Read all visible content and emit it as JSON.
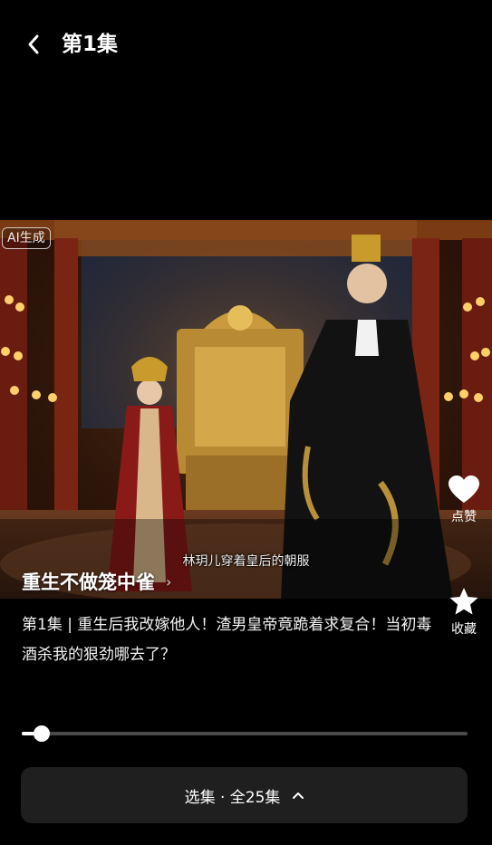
{
  "header": {
    "title": "第1集"
  },
  "video": {
    "ai_badge": "AI生成",
    "subtitle": "林玥儿穿着皇后的朝服",
    "drama_title": "重生不做笼中雀"
  },
  "actions": {
    "like_label": "点赞",
    "favorite_label": "收藏"
  },
  "description": "第1集 | 重生后我改嫁他人！渣男皇帝竟跪着求复合！当初毒酒杀我的狠劲哪去了？",
  "playback": {
    "progress": 0.045
  },
  "episode_selector": {
    "label": "选集 · 全25集"
  }
}
